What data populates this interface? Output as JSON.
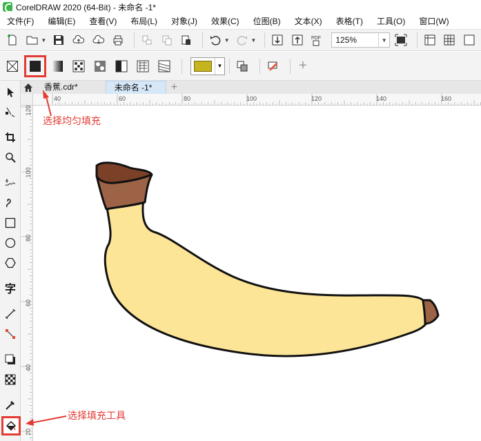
{
  "window": {
    "title": "CorelDRAW 2020 (64-Bit) - 未命名 -1*"
  },
  "menu": {
    "items": [
      "文件(F)",
      "编辑(E)",
      "查看(V)",
      "布局(L)",
      "对象(J)",
      "效果(C)",
      "位图(B)",
      "文本(X)",
      "表格(T)",
      "工具(O)",
      "窗口(W)"
    ]
  },
  "toolbar": {
    "zoom_value": "125%",
    "pdf_label": "PDF"
  },
  "property_bar": {
    "fill_color": "#c5b41e",
    "plus_label": "+"
  },
  "tabs": {
    "items": [
      {
        "label": "香蕉.cdr*"
      },
      {
        "label": "未命名 -1*"
      }
    ],
    "add_label": "+"
  },
  "rulers": {
    "horizontal": [
      "40",
      "60",
      "80",
      "100",
      "120",
      "140",
      "160"
    ],
    "vertical": [
      "120",
      "100",
      "80",
      "60",
      "40",
      "20"
    ]
  },
  "tools": {
    "text_tool_glyph": "字"
  },
  "annotations": {
    "uniform_fill": "选择均匀填充",
    "fill_tool": "选择填充工具"
  },
  "colors": {
    "annotation_red": "#e23b32",
    "banana_body": "#fde597",
    "banana_stem_dark": "#7a4028",
    "banana_stem_light": "#9c6347",
    "banana_tip": "#9c6347"
  }
}
